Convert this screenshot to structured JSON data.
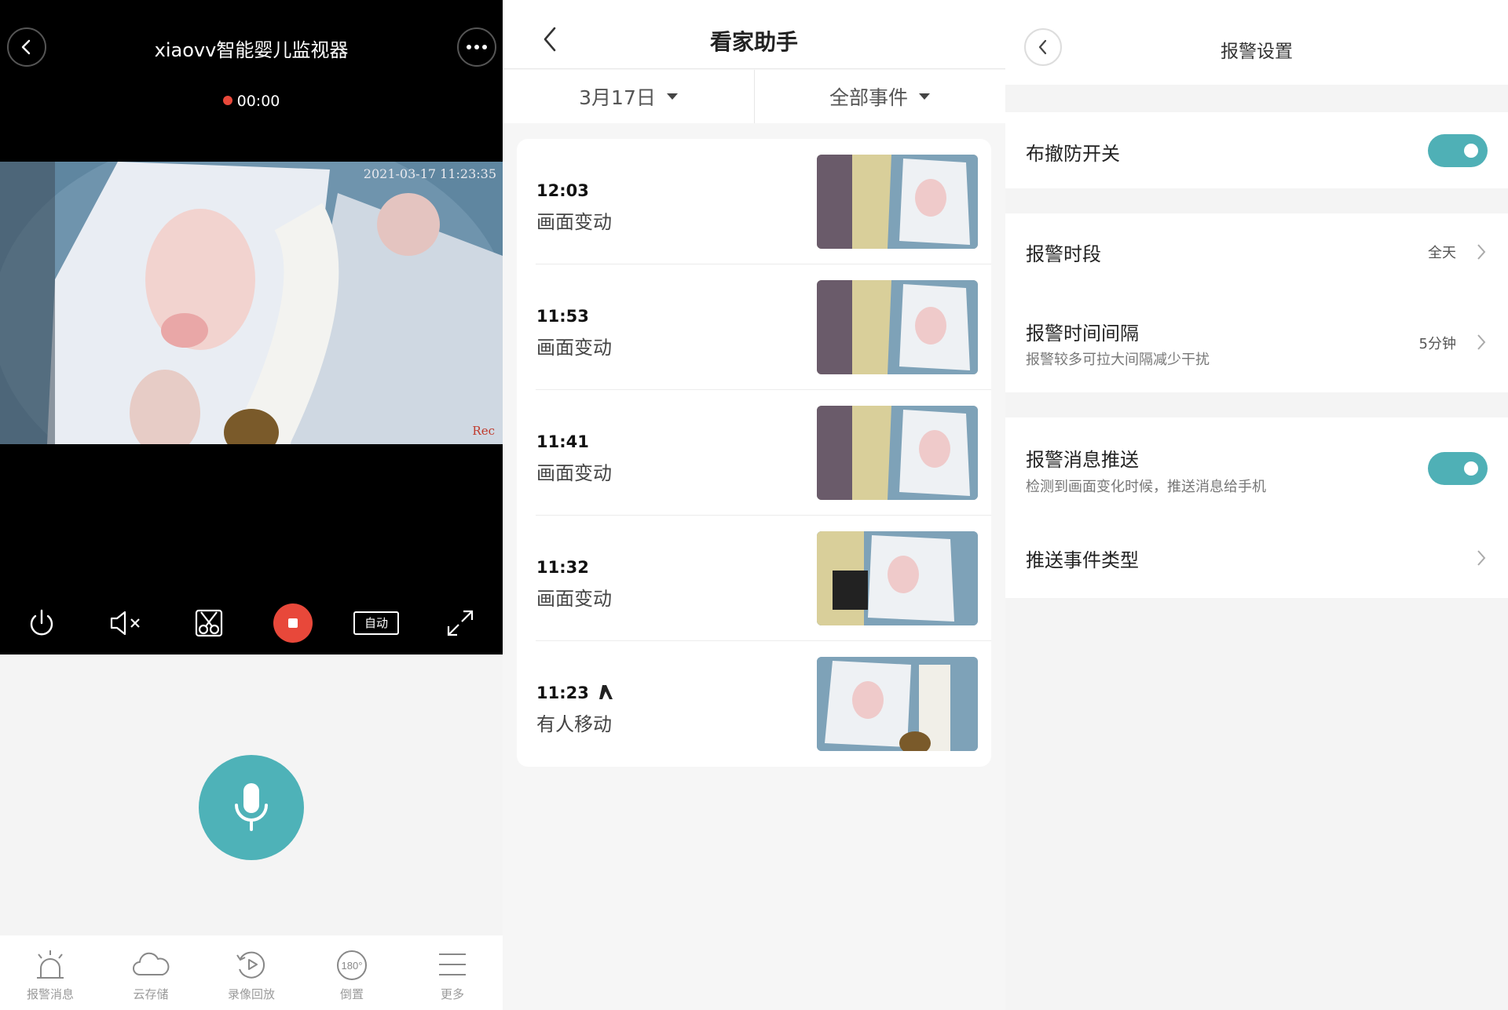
{
  "live": {
    "title": "xiaovv智能婴儿监视器",
    "rec_time": "00:00",
    "timestamp": "2021-03-17 11:23:35",
    "rec_mark": "Rec",
    "quality_label": "自动",
    "tabs": [
      {
        "label": "报警消息",
        "icon": "alarm-icon"
      },
      {
        "label": "云存储",
        "icon": "cloud-icon"
      },
      {
        "label": "录像回放",
        "icon": "playback-icon"
      },
      {
        "label": "倒置",
        "icon": "rotate-180-icon",
        "icon_text": "180°"
      },
      {
        "label": "更多",
        "icon": "menu-icon"
      }
    ],
    "accent": "#4eb2b8",
    "record_color": "#e8483a"
  },
  "assistant": {
    "title": "看家助手",
    "date_filter": "3月17日",
    "event_filter": "全部事件",
    "events": [
      {
        "time": "12:03",
        "type": "画面变动"
      },
      {
        "time": "11:53",
        "type": "画面变动"
      },
      {
        "time": "11:41",
        "type": "画面变动"
      },
      {
        "time": "11:32",
        "type": "画面变动"
      },
      {
        "time": "11:23",
        "type": "有人移动",
        "icon": "person-walking-icon"
      }
    ]
  },
  "alarm": {
    "title": "报警设置",
    "arm_switch": {
      "label": "布撤防开关",
      "on": true
    },
    "period": {
      "label": "报警时段",
      "value": "全天"
    },
    "interval": {
      "label": "报警时间间隔",
      "sub": "报警较多可拉大间隔减少干扰",
      "value": "5分钟"
    },
    "push": {
      "label": "报警消息推送",
      "sub": "检测到画面变化时候，推送消息给手机",
      "on": true
    },
    "push_type": {
      "label": "推送事件类型"
    },
    "accent": "#4fb0b6"
  }
}
